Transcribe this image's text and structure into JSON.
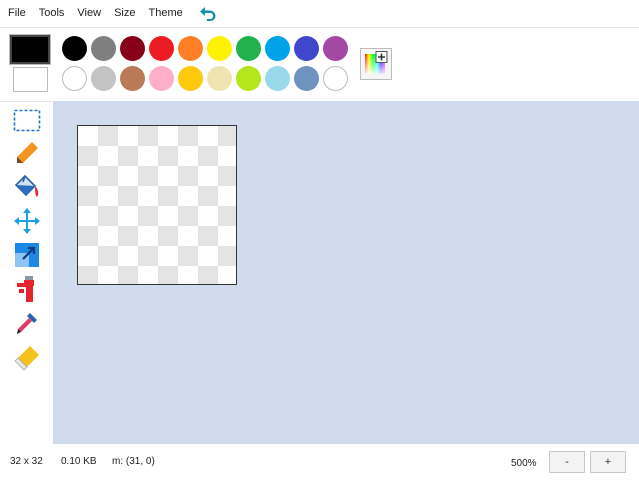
{
  "menu": {
    "file": "File",
    "tools": "Tools",
    "view": "View",
    "size": "Size",
    "theme": "Theme"
  },
  "icons": {
    "undo": "undo-icon",
    "color_picker": "color-picker-icon",
    "tools": [
      "rectangle-select-icon",
      "pencil-icon",
      "paint-bucket-icon",
      "move-icon",
      "resize-icon",
      "spray-paint-icon",
      "eyedropper-icon",
      "eraser-icon"
    ]
  },
  "palette": {
    "primary_color": "#000000",
    "secondary_color": "#ffffff",
    "row1": [
      "#000000",
      "#7f7f7f",
      "#880015",
      "#ed1c24",
      "#ff7f27",
      "#fff200",
      "#22b14c",
      "#00a2e8",
      "#3f48cc",
      "#a349a4"
    ],
    "row2": [
      "#ffffff",
      "#c3c3c3",
      "#b97a57",
      "#ffaec9",
      "#ffc90e",
      "#efe4b0",
      "#b5e61d",
      "#99d9ea",
      "#7092be",
      "#ffffff"
    ]
  },
  "workspace": {
    "background": "#d0dcee"
  },
  "status": {
    "dimensions": "32 x 32",
    "file_size": "0.10 KB",
    "mouse": "m: (31, 0)",
    "zoom": "500%",
    "zoom_out": "-",
    "zoom_in": "+"
  }
}
